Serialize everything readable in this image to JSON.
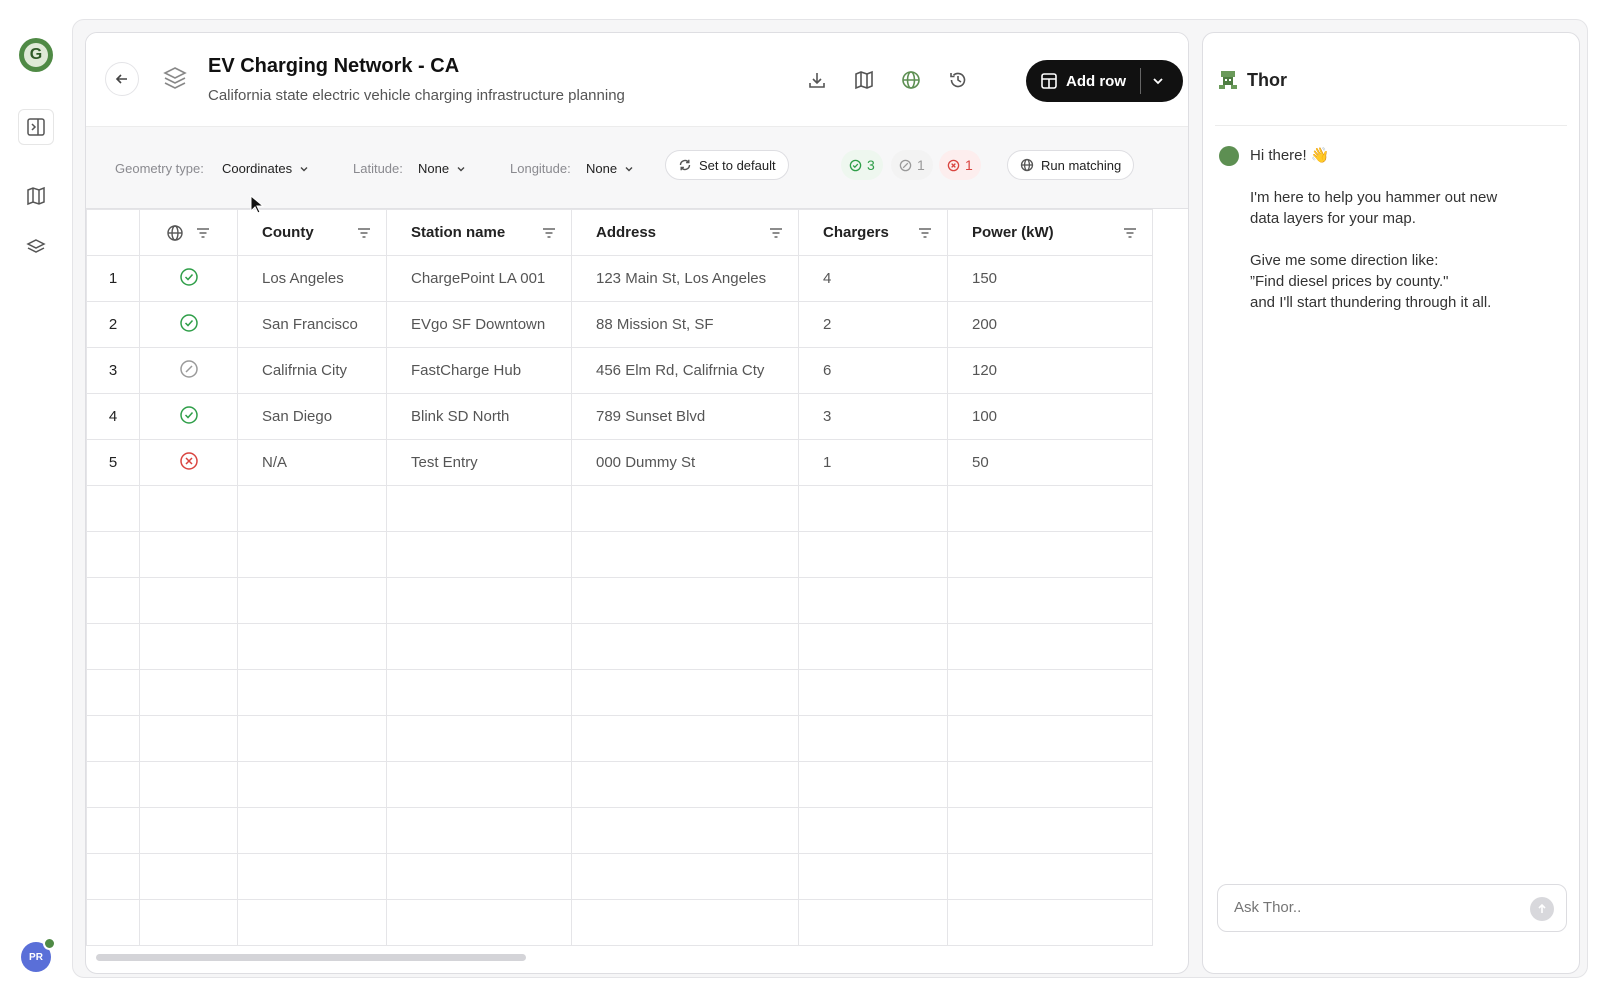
{
  "rail": {
    "logo_letter": "G",
    "avatar_initials": "PR",
    "items": [
      {
        "icon": "sidebar-toggle-icon"
      },
      {
        "icon": "map-icon"
      },
      {
        "icon": "layers-icon"
      }
    ]
  },
  "header": {
    "title": "EV Charging Network - CA",
    "subtitle": "California state electric vehicle charging infrastructure planning",
    "add_row_label": "Add row",
    "actions": [
      "download-icon",
      "map-icon",
      "globe-icon",
      "history-icon"
    ]
  },
  "toolbar": {
    "geometry_label": "Geometry type:",
    "geometry_value": "Coordinates",
    "latitude_label": "Latitude:",
    "latitude_value": "None",
    "longitude_label": "Longitude:",
    "longitude_value": "None",
    "set_default_label": "Set to default",
    "counts": {
      "matched": "3",
      "unmatched": "1",
      "error": "1"
    },
    "run_matching_label": "Run matching"
  },
  "table": {
    "columns": [
      "County",
      "Station name",
      "Address",
      "Chargers",
      "Power (kW)"
    ],
    "rows": [
      {
        "n": "1",
        "status": "matched",
        "county": "Los Angeles",
        "station": "ChargePoint LA 001",
        "address": "123 Main St, Los Angeles",
        "chargers": "4",
        "power": "150"
      },
      {
        "n": "2",
        "status": "matched",
        "county": "San Francisco",
        "station": "EVgo SF Downtown",
        "address": "88 Mission St, SF",
        "chargers": "2",
        "power": "200"
      },
      {
        "n": "3",
        "status": "unmatched",
        "county": "Califrnia City",
        "station": "FastCharge Hub",
        "address": "456 Elm Rd, Califrnia Cty",
        "chargers": "6",
        "power": "120"
      },
      {
        "n": "4",
        "status": "matched",
        "county": "San Diego",
        "station": "Blink SD North",
        "address": "789 Sunset Blvd",
        "chargers": "3",
        "power": "100"
      },
      {
        "n": "5",
        "status": "error",
        "county": "N/A",
        "station": "Test Entry",
        "address": "000 Dummy St",
        "chargers": "1",
        "power": "50"
      }
    ],
    "empty_rows": 10
  },
  "chat": {
    "name": "Thor",
    "greeting": "Hi there! 👋",
    "intro_line1": "I'm here to help you hammer out new",
    "intro_line2": "data layers for your map.",
    "hint_line1": "Give me some direction like:",
    "hint_line2": "”Find diesel prices by county.\"",
    "hint_line3": "and I'll start thundering through it all.",
    "input_placeholder": "Ask Thor.."
  },
  "colors": {
    "matched": "#2e9e48",
    "unmatched": "#9a9a9a",
    "error": "#d9443f",
    "brand": "#4f8a45"
  }
}
